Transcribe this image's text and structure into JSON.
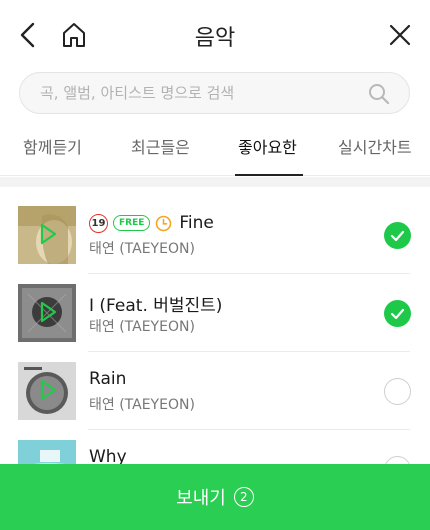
{
  "header": {
    "title": "음악",
    "back_icon": "chevron-left-icon",
    "home_icon": "home-icon",
    "close_icon": "close-icon"
  },
  "search": {
    "placeholder": "곡, 앨범, 아티스트 명으로 검색",
    "value": "",
    "icon": "search-icon"
  },
  "tabs": [
    {
      "label": "함께듣기",
      "active": false
    },
    {
      "label": "최근들은",
      "active": false
    },
    {
      "label": "좋아요한",
      "active": true
    },
    {
      "label": "실시간차트",
      "active": false
    }
  ],
  "songs": [
    {
      "title": "Fine",
      "artist": "태연 (TAEYEON)",
      "badges": [
        "19",
        "FREE",
        "clock"
      ],
      "selected": true
    },
    {
      "title": "I (Feat. 버벌진트)",
      "artist": "태연 (TAEYEON)",
      "badges": [],
      "selected": true
    },
    {
      "title": "Rain",
      "artist": "태연 (TAEYEON)",
      "badges": [],
      "selected": false
    },
    {
      "title": "Why",
      "artist": "",
      "badges": [],
      "selected": false
    }
  ],
  "send_bar": {
    "label": "보내기",
    "count": "2"
  },
  "colors": {
    "accent_green": "#2ace52",
    "check_green": "#1ec94a",
    "badge_19_red": "#e5322d",
    "clock_orange": "#f5a623"
  }
}
